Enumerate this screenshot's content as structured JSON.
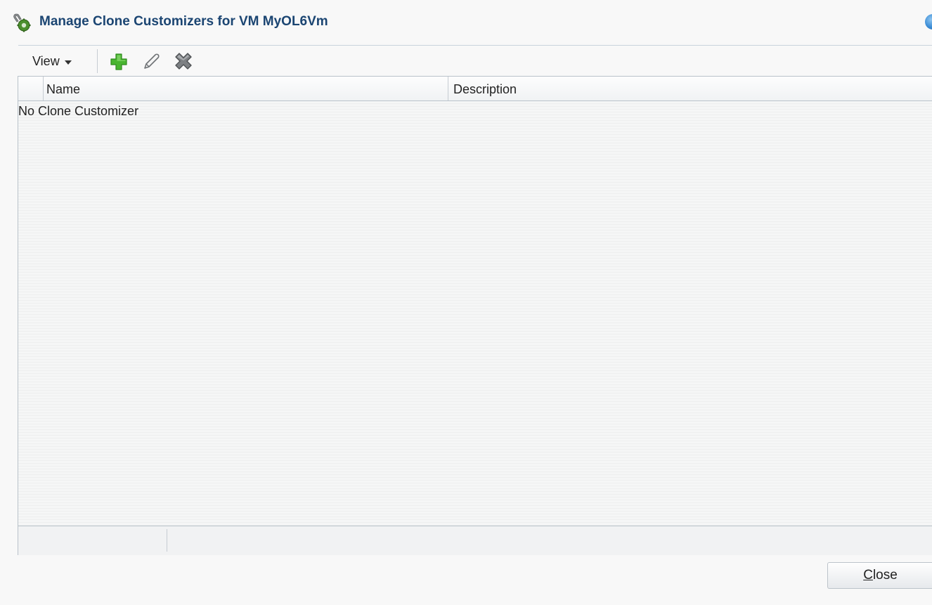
{
  "dialog": {
    "title": "Manage Clone Customizers for VM MyOL6Vm",
    "title_icon": "clone-customizer-icon",
    "help_icon": "help-icon"
  },
  "toolbar": {
    "view_label": "View",
    "add_icon": "add-icon",
    "edit_icon": "edit-pencil-icon",
    "delete_icon": "delete-x-icon"
  },
  "table": {
    "columns": [
      "Name",
      "Description"
    ],
    "empty_message": "No Clone Customizer"
  },
  "footer": {
    "close_mnemonic": "C",
    "close_rest": "lose"
  },
  "colors": {
    "title": "#1b4572",
    "add_green": "#3fae2a",
    "border": "#b9c2ca"
  }
}
